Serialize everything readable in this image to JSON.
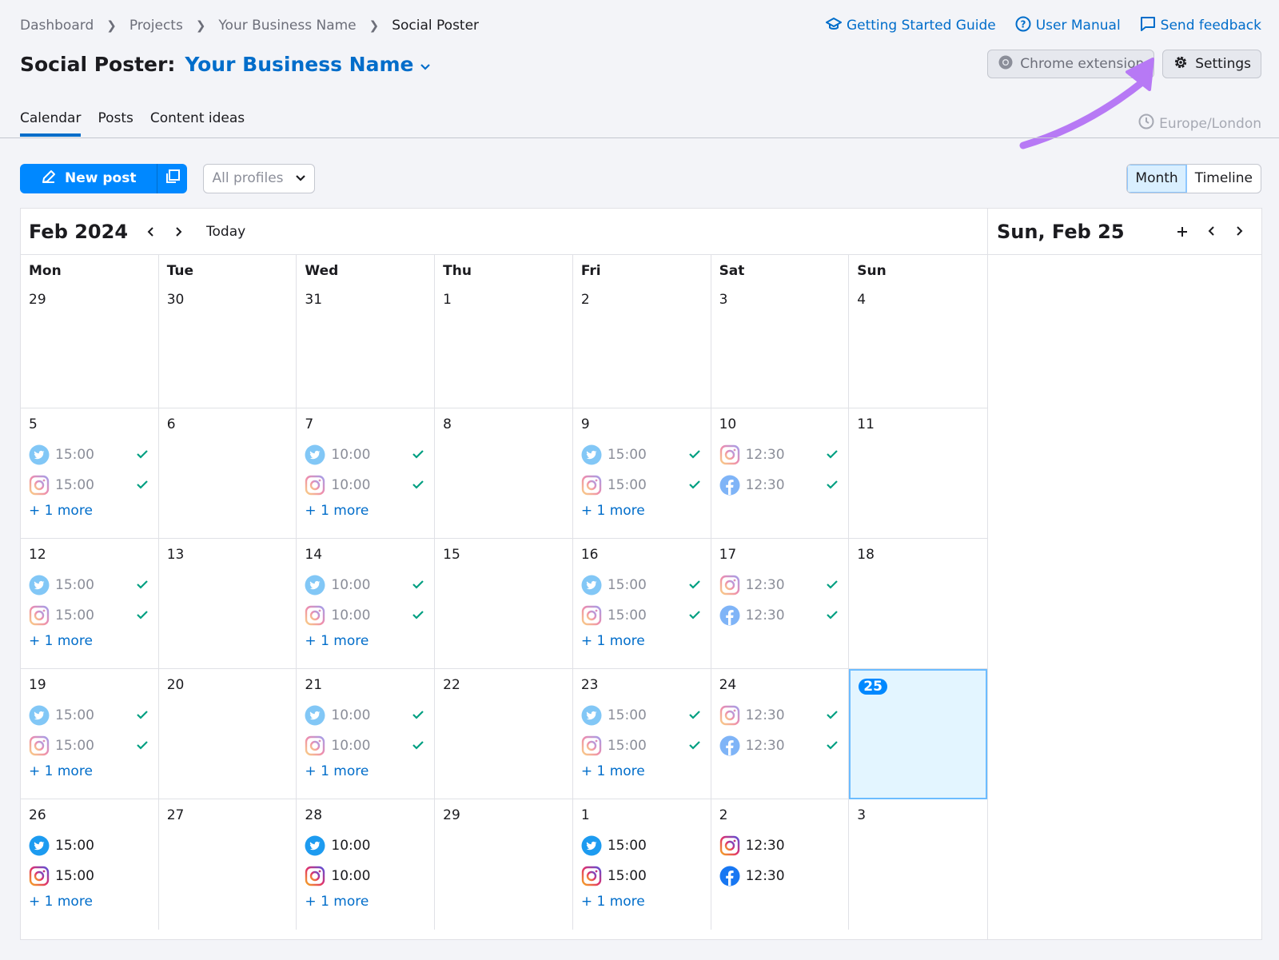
{
  "breadcrumb": [
    "Dashboard",
    "Projects",
    "Your Business Name",
    "Social Poster"
  ],
  "top_links": {
    "guide": "Getting Started Guide",
    "manual": "User Manual",
    "feedback": "Send feedback"
  },
  "header": {
    "title": "Social Poster:",
    "business": "Your Business Name",
    "chrome_extension": "Chrome extension",
    "settings": "Settings"
  },
  "tabs": [
    "Calendar",
    "Posts",
    "Content ideas"
  ],
  "timezone": "Europe/London",
  "toolbar": {
    "new_post": "New post",
    "profiles": "All profiles",
    "view_month": "Month",
    "view_timeline": "Timeline"
  },
  "calendar": {
    "month_title": "Feb 2024",
    "today": "Today",
    "weekdays": [
      "Mon",
      "Tue",
      "Wed",
      "Thu",
      "Fri",
      "Sat",
      "Sun"
    ],
    "more_label": "+ 1 more",
    "weeks": [
      [
        {
          "day": "29"
        },
        {
          "day": "30"
        },
        {
          "day": "31"
        },
        {
          "day": "1"
        },
        {
          "day": "2"
        },
        {
          "day": "3"
        },
        {
          "day": "4"
        }
      ],
      [
        {
          "day": "5",
          "posts": [
            {
              "net": "twitter",
              "time": "15:00"
            },
            {
              "net": "instagram",
              "time": "15:00"
            }
          ],
          "more": true
        },
        {
          "day": "6"
        },
        {
          "day": "7",
          "posts": [
            {
              "net": "twitter",
              "time": "10:00"
            },
            {
              "net": "instagram",
              "time": "10:00"
            }
          ],
          "more": true
        },
        {
          "day": "8"
        },
        {
          "day": "9",
          "posts": [
            {
              "net": "twitter",
              "time": "15:00"
            },
            {
              "net": "instagram",
              "time": "15:00"
            }
          ],
          "more": true
        },
        {
          "day": "10",
          "posts": [
            {
              "net": "instagram",
              "time": "12:30"
            },
            {
              "net": "facebook",
              "time": "12:30"
            }
          ]
        },
        {
          "day": "11"
        }
      ],
      [
        {
          "day": "12",
          "posts": [
            {
              "net": "twitter",
              "time": "15:00"
            },
            {
              "net": "instagram",
              "time": "15:00"
            }
          ],
          "more": true
        },
        {
          "day": "13"
        },
        {
          "day": "14",
          "posts": [
            {
              "net": "twitter",
              "time": "10:00"
            },
            {
              "net": "instagram",
              "time": "10:00"
            }
          ],
          "more": true
        },
        {
          "day": "15"
        },
        {
          "day": "16",
          "posts": [
            {
              "net": "twitter",
              "time": "15:00"
            },
            {
              "net": "instagram",
              "time": "15:00"
            }
          ],
          "more": true
        },
        {
          "day": "17",
          "posts": [
            {
              "net": "instagram",
              "time": "12:30"
            },
            {
              "net": "facebook",
              "time": "12:30"
            }
          ]
        },
        {
          "day": "18"
        }
      ],
      [
        {
          "day": "19",
          "posts": [
            {
              "net": "twitter",
              "time": "15:00"
            },
            {
              "net": "instagram",
              "time": "15:00"
            }
          ],
          "more": true
        },
        {
          "day": "20"
        },
        {
          "day": "21",
          "posts": [
            {
              "net": "twitter",
              "time": "10:00"
            },
            {
              "net": "instagram",
              "time": "10:00"
            }
          ],
          "more": true
        },
        {
          "day": "22"
        },
        {
          "day": "23",
          "posts": [
            {
              "net": "twitter",
              "time": "15:00"
            },
            {
              "net": "instagram",
              "time": "15:00"
            }
          ],
          "more": true
        },
        {
          "day": "24",
          "posts": [
            {
              "net": "instagram",
              "time": "12:30"
            },
            {
              "net": "facebook",
              "time": "12:30"
            }
          ]
        },
        {
          "day": "25",
          "selected": true
        }
      ],
      [
        {
          "day": "26",
          "posts": [
            {
              "net": "twitter",
              "time": "15:00"
            },
            {
              "net": "instagram",
              "time": "15:00"
            }
          ],
          "more": true,
          "upcoming": true
        },
        {
          "day": "27"
        },
        {
          "day": "28",
          "posts": [
            {
              "net": "twitter",
              "time": "10:00"
            },
            {
              "net": "instagram",
              "time": "10:00"
            }
          ],
          "more": true,
          "upcoming": true
        },
        {
          "day": "29"
        },
        {
          "day": "1",
          "posts": [
            {
              "net": "twitter",
              "time": "15:00"
            },
            {
              "net": "instagram",
              "time": "15:00"
            }
          ],
          "more": true,
          "upcoming": true
        },
        {
          "day": "2",
          "posts": [
            {
              "net": "instagram",
              "time": "12:30"
            },
            {
              "net": "facebook",
              "time": "12:30"
            }
          ],
          "upcoming": true
        },
        {
          "day": "3"
        }
      ]
    ]
  },
  "side_panel": {
    "title": "Sun, Feb 25"
  },
  "colors": {
    "accent": "#006dca",
    "primary_button": "#0088ff",
    "check": "#009f81",
    "annotation_arrow": "#b779f5",
    "selected_day_bg": "#e3f5ff"
  }
}
